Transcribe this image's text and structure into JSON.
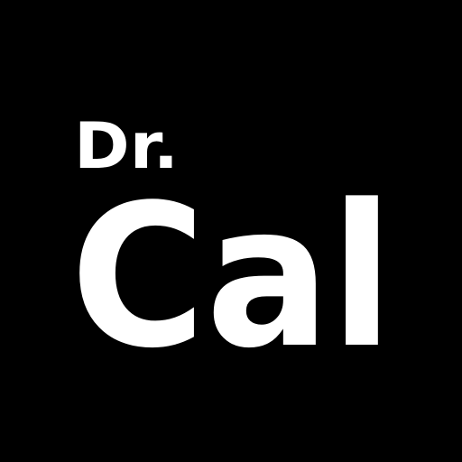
{
  "icon": {
    "prefix": "Dr.",
    "name": "Cal",
    "background_color": "#000000",
    "text_color": "#ffffff"
  }
}
